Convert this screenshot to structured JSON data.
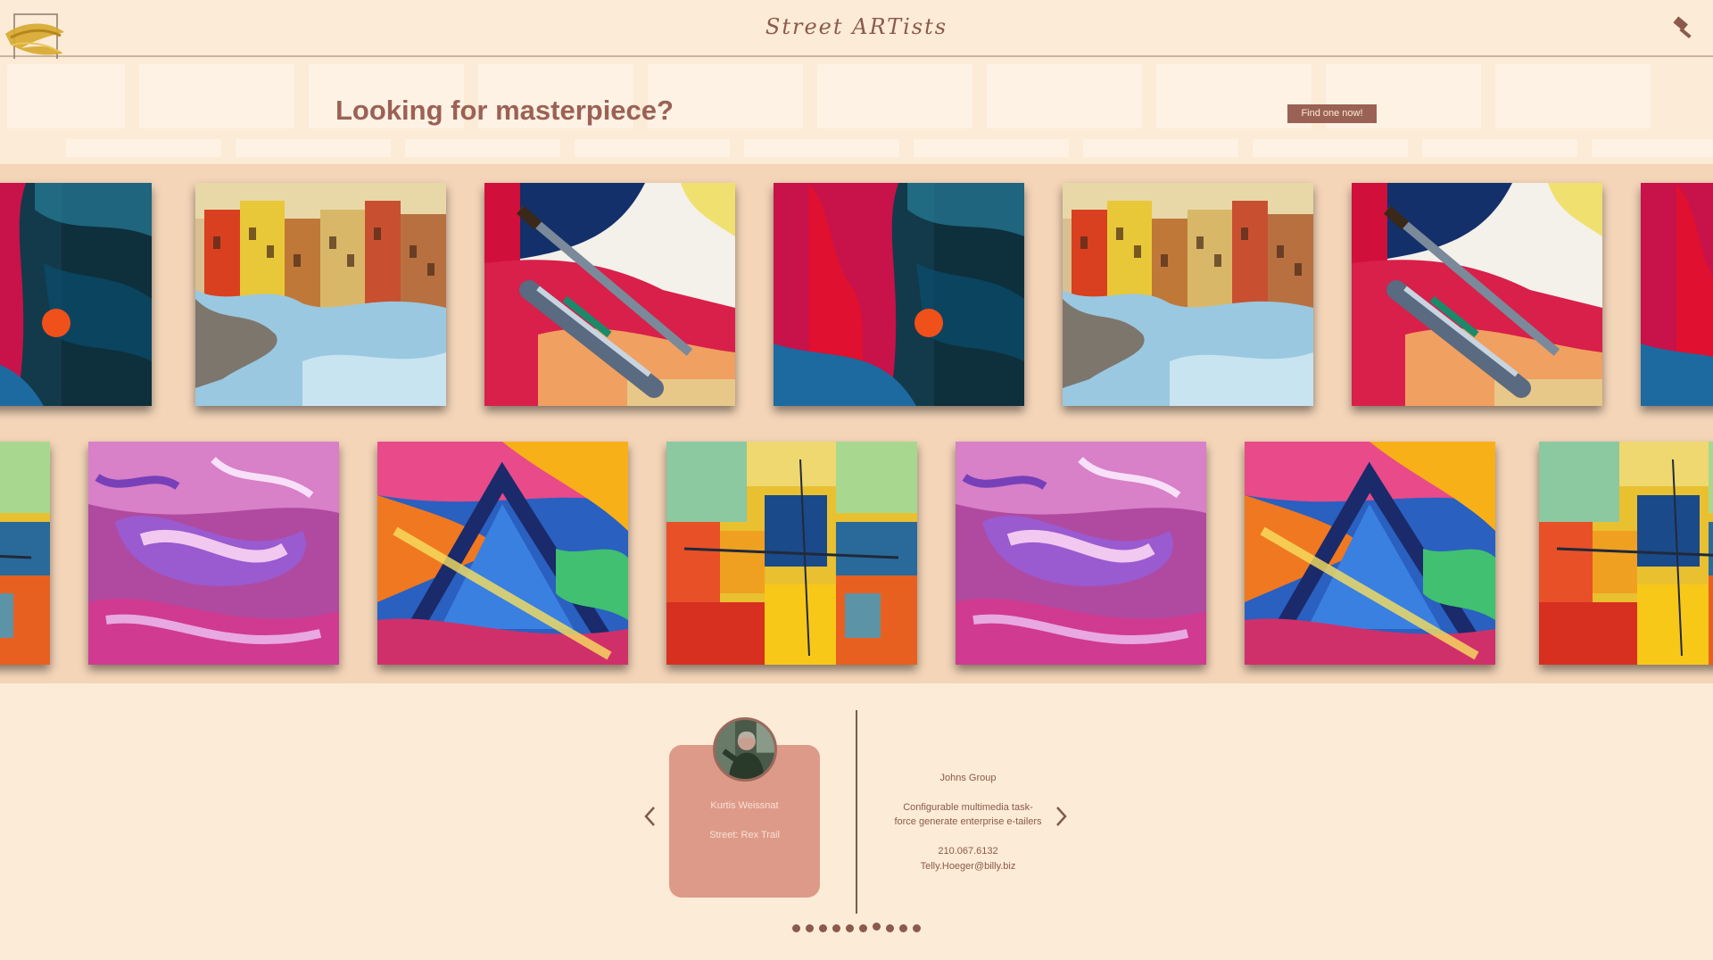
{
  "header": {
    "title": "Street ARTists",
    "logo_icon": "paint-stroke-logo-icon",
    "tool_icon": "hammer-icon"
  },
  "hero": {
    "headline": "Looking for masterpiece?",
    "cta_label": "Find one now!"
  },
  "gallery": {
    "row1": [
      "abstract-red-blue-painting",
      "canal-reflection-painting",
      "paintbrush-palette-painting",
      "abstract-red-blue-painting",
      "canal-reflection-painting",
      "paintbrush-palette-painting",
      "abstract-red-blue-painting"
    ],
    "row2": [
      "colorful-blocks-painting",
      "purple-swirl-painting",
      "triangle-abstract-painting",
      "colorful-blocks-painting",
      "purple-swirl-painting",
      "triangle-abstract-painting",
      "colorful-blocks-painting"
    ]
  },
  "carousel": {
    "prev_icon": "chevron-left-icon",
    "next_icon": "chevron-right-icon",
    "artist": {
      "name": "Kurtis Weissnat",
      "street": "Street: Rex Trail"
    },
    "company": {
      "name": "Johns Group",
      "catch_phrase_line1": "Configurable multimedia task-",
      "catch_phrase_line2": "force generate enterprise e-tailers",
      "phone": "210.067.6132",
      "email": "Telly.Hoeger@billy.biz"
    },
    "pagination": {
      "count": 10,
      "active_index": 6
    }
  },
  "colors": {
    "background": "#fcebd6",
    "accent": "#9a6255",
    "card": "#de9a88",
    "gallery_band": "#f4d5b8"
  }
}
